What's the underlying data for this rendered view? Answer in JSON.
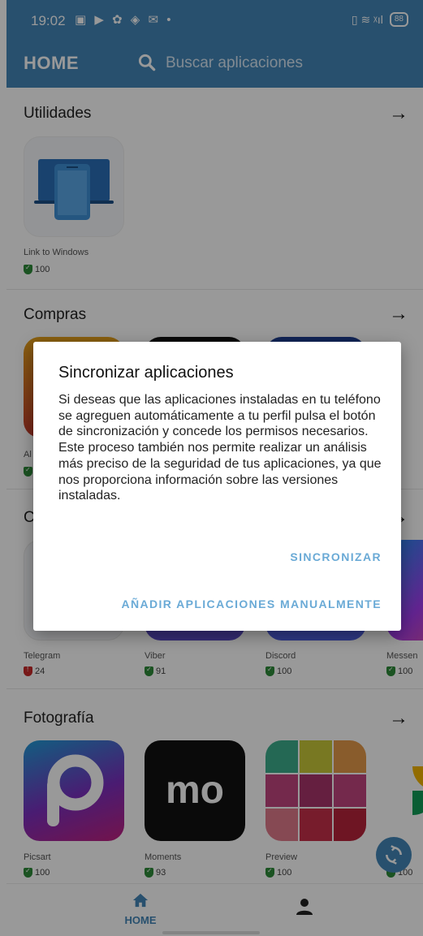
{
  "status_bar": {
    "time": "19:02",
    "notif_icons": "▣ ▶ ✿ ◈ ✉ •",
    "right_icons": "▯ ≋ ᵡıl",
    "battery": "88"
  },
  "header": {
    "title": "HOME",
    "search_placeholder": "Buscar aplicaciones",
    "color": "#4386b8"
  },
  "sections": [
    {
      "title": "Utilidades",
      "apps": [
        {
          "name": "Link to Windows",
          "score": "100",
          "shield": "green"
        }
      ]
    },
    {
      "title": "Compras",
      "apps": [
        {
          "name": "Al",
          "score": "",
          "shield": "green"
        }
      ]
    },
    {
      "title": "C",
      "apps": [
        {
          "name": "Telegram",
          "score": "24",
          "shield": "red"
        },
        {
          "name": "Viber",
          "score": "91",
          "shield": "green"
        },
        {
          "name": "Discord",
          "score": "100",
          "shield": "green"
        },
        {
          "name": "Messen",
          "score": "100",
          "shield": "green"
        }
      ]
    },
    {
      "title": "Fotografía",
      "apps": [
        {
          "name": "Picsart",
          "score": "100",
          "shield": "green"
        },
        {
          "name": "Moments",
          "score": "93",
          "shield": "green"
        },
        {
          "name": "Preview",
          "score": "100",
          "shield": "green"
        },
        {
          "name": "",
          "score": "100",
          "shield": "green"
        }
      ]
    }
  ],
  "dialog": {
    "title": "Sincronizar aplicaciones",
    "body": "Si deseas que las aplicaciones instaladas en tu teléfono se agreguen automáticamente a tu perfil pulsa el botón de sincronización y concede los permisos necesarios.\nEste proceso también nos permite realizar un análisis más preciso de la seguridad de tus aplicaciones, ya que nos proporciona información sobre las versiones instaladas.",
    "sync_button": "SINCRONIZAR",
    "manual_button": "AÑADIR APLICACIONES MANUALMENTE",
    "button_color": "#6aaad6"
  },
  "bottom_nav": {
    "home_label": "HOME"
  },
  "icons": {
    "search": "search-icon",
    "arrow": "arrow-right-icon",
    "home": "home-icon",
    "profile": "person-icon",
    "fab": "sync-icon"
  }
}
